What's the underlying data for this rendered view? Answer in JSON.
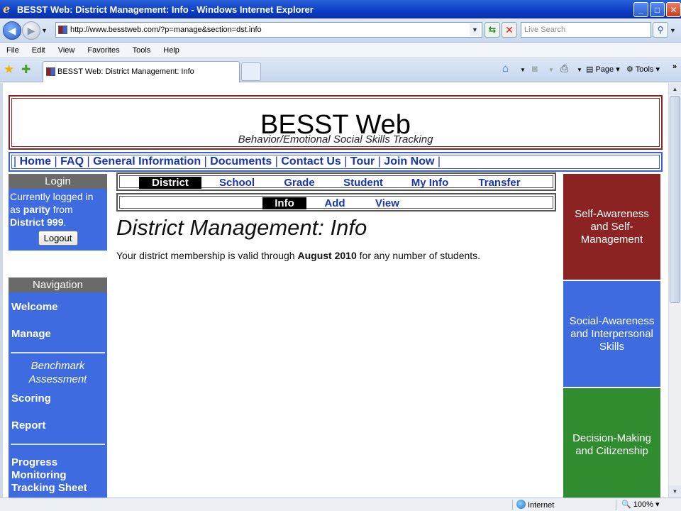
{
  "window": {
    "title": "BESST Web: District Management: Info - Windows Internet Explorer",
    "min": "_",
    "max": "□",
    "close": "✕"
  },
  "addressbar": {
    "url": "http://www.besstweb.com/?p=manage&section=dst.info",
    "search_placeholder": "Live Search"
  },
  "menu": [
    "File",
    "Edit",
    "View",
    "Favorites",
    "Tools",
    "Help"
  ],
  "tabs": {
    "active_title": "BESST Web: District Management: Info"
  },
  "commandbar": {
    "page": "Page",
    "tools": "Tools"
  },
  "statusbar": {
    "zone": "Internet",
    "zoom": "100%"
  },
  "site": {
    "title": "BESST Web",
    "subtitle": "Behavior/Emotional Social Skills Tracking",
    "nav": [
      "Home",
      "FAQ",
      "General Information",
      "Documents",
      "Contact Us",
      "Tour",
      "Join Now"
    ]
  },
  "login": {
    "header": "Login",
    "line_prefix": "Currently logged in as ",
    "user": "parity",
    "from": " from ",
    "district": "District 999",
    "period": ".",
    "logout": "Logout"
  },
  "navigation": {
    "header": "Navigation",
    "welcome": "Welcome",
    "manage": "Manage",
    "benchmark": "Benchmark Assessment",
    "scoring": "Scoring",
    "report": "Report",
    "progress": "Progress Monitoring Tracking Sheet"
  },
  "district_tabs": [
    "District",
    "School",
    "Grade",
    "Student",
    "My Info",
    "Transfer"
  ],
  "section_tabs": [
    "Info",
    "Add",
    "View"
  ],
  "main": {
    "heading": "District Management: Info",
    "text_before": "Your district membership is valid through ",
    "valid_until": "August 2010",
    "text_after": " for any number of students."
  },
  "panels": {
    "self": "Self-Awareness and Self-Management",
    "social": "Social-Awareness and Interpersonal Skills",
    "decision": "Decision-Making and Citizenship"
  },
  "colors": {
    "brand_red": "#8b2323",
    "brand_blue": "#3f6be0",
    "brand_green": "#2f8c2f"
  }
}
